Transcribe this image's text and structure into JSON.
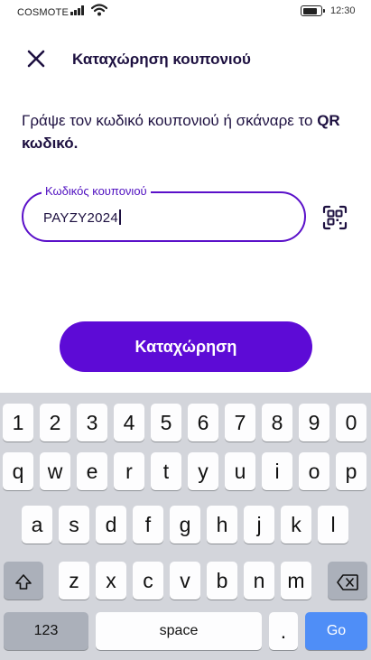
{
  "status_bar": {
    "carrier": "COSMOTE",
    "time": "12:30",
    "battery_level": 0.85
  },
  "header": {
    "title": "Καταχώρηση κουπονιού",
    "close_icon": "close-icon"
  },
  "instruction": {
    "text": "Γράψε τον κωδικό κουπονιού ή σκάναρε το ",
    "bold": "QR κωδικό."
  },
  "coupon_field": {
    "label": "Κωδικός κουπονιού",
    "value": "PAYZY2024"
  },
  "qr_scan_icon": "qr-scan-icon",
  "submit_button": {
    "label": "Καταχώρηση"
  },
  "colors": {
    "accent": "#5d0bd6",
    "text": "#1d1040",
    "keyboard_bg": "#d3d5db",
    "go_key": "#4f8ef7"
  },
  "keyboard": {
    "row_numbers": [
      "1",
      "2",
      "3",
      "4",
      "5",
      "6",
      "7",
      "8",
      "9",
      "0"
    ],
    "row_1": [
      "q",
      "w",
      "e",
      "r",
      "t",
      "y",
      "u",
      "i",
      "o",
      "p"
    ],
    "row_2": [
      "a",
      "s",
      "d",
      "f",
      "g",
      "h",
      "j",
      "k",
      "l"
    ],
    "row_3": [
      "z",
      "x",
      "c",
      "v",
      "b",
      "n",
      "m"
    ],
    "shift_icon": "shift-icon",
    "backspace_icon": "backspace-icon",
    "numbers_label": "123",
    "space_label": "space",
    "period_label": ".",
    "go_label": "Go"
  }
}
